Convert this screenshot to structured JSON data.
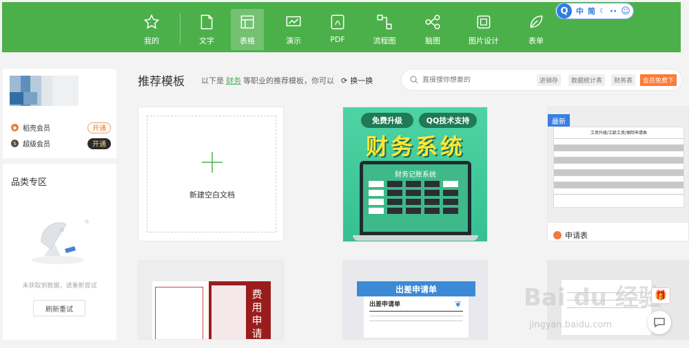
{
  "nav": {
    "items": [
      {
        "label": "我的",
        "icon": "star-icon"
      },
      {
        "label": "文字",
        "icon": "document-icon"
      },
      {
        "label": "表格",
        "icon": "table-icon"
      },
      {
        "label": "演示",
        "icon": "presentation-icon"
      },
      {
        "label": "PDF",
        "icon": "pdf-icon"
      },
      {
        "label": "流程图",
        "icon": "flowchart-icon"
      },
      {
        "label": "脑图",
        "icon": "mindmap-icon"
      },
      {
        "label": "图片设计",
        "icon": "image-design-icon"
      },
      {
        "label": "表单",
        "icon": "form-leaf-icon"
      }
    ],
    "active": "表格"
  },
  "ime": {
    "logo": "Q",
    "mode_cn": "中",
    "mode_simplified": "简"
  },
  "sidebar": {
    "members": [
      {
        "name": "稻壳会员",
        "action": "开通"
      },
      {
        "name": "超级会员",
        "action": "开通"
      }
    ],
    "category": {
      "title": "品类专区",
      "empty_text": "未获取到数据，请重新尝试",
      "retry_label": "刷新重试"
    }
  },
  "main": {
    "title": "推荐模板",
    "subtitle_prefix": "以下是",
    "subtitle_highlight": "财务",
    "subtitle_suffix": "等职业的推荐模板，你可以",
    "refresh_label": "换一换"
  },
  "search": {
    "placeholder": "直接搜你想要的",
    "tags": [
      "进销存",
      "数据统计表",
      "财务表"
    ],
    "vip_tag": "会员免费下"
  },
  "cards": {
    "new_doc_label": "新建空白文档",
    "finance": {
      "pill_left": "免费升级",
      "pill_right": "QQ技术支持",
      "title": "财务系统",
      "screen_title": "财务记账系统"
    },
    "apply": {
      "badge": "最新",
      "form_title": "工资升级/工龄工资/保险申请表",
      "label": "申请表"
    },
    "expense": {
      "text": "费用申请"
    },
    "travel": {
      "header": "出差申请单",
      "paper_title": "出差申请单"
    }
  },
  "watermark": {
    "main": "Bai du 经验",
    "sub": "jingyan.baidu.com"
  },
  "colors": {
    "brand_green": "#4cb04a",
    "accent_orange": "#ff7a35",
    "badge_blue": "#3a7fe0"
  }
}
